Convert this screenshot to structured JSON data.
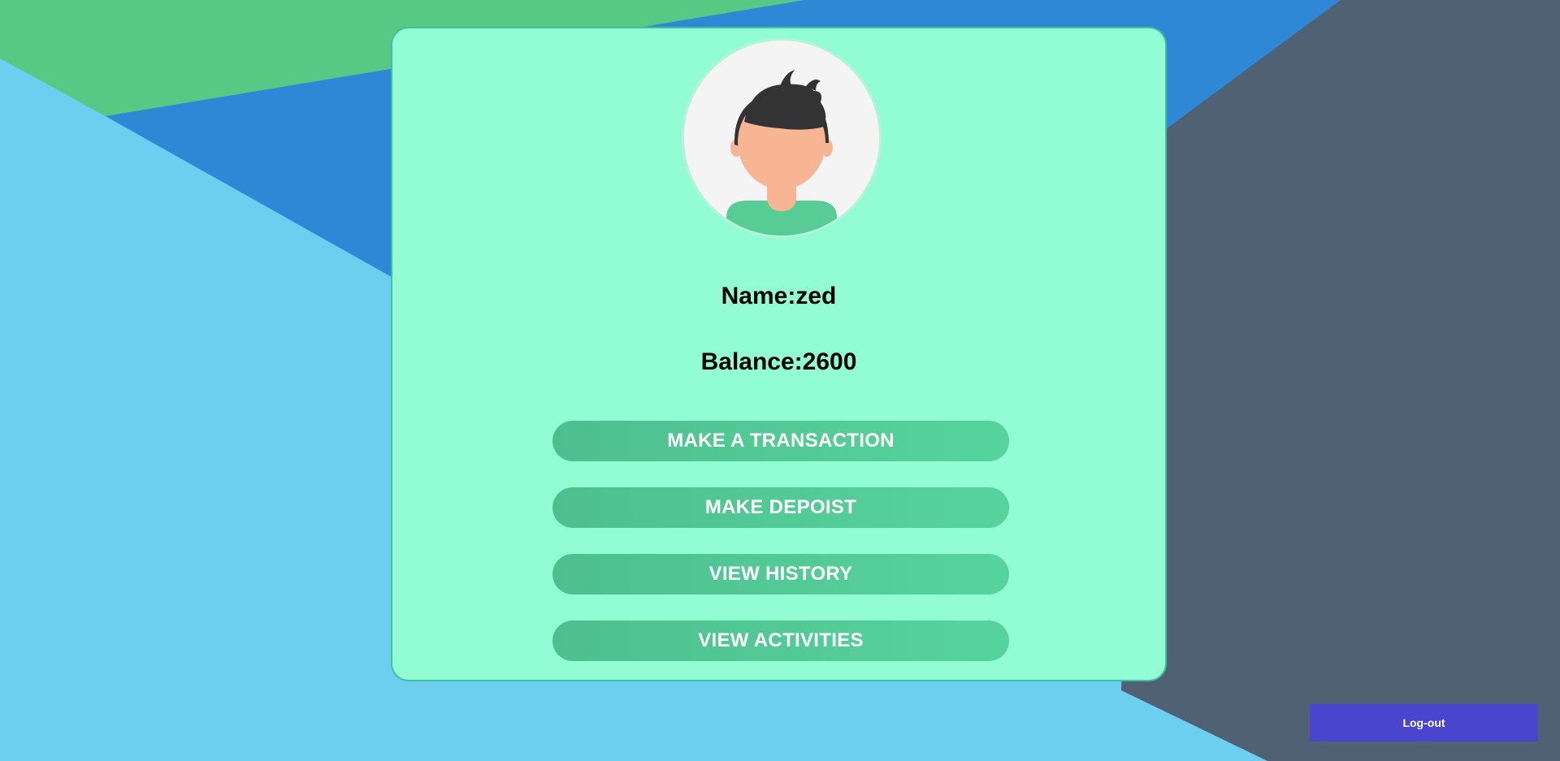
{
  "profile": {
    "name_text": "Name:zed",
    "balance_text": "Balance:2600"
  },
  "actions": {
    "make_transaction": "MAKE A TRANSACTION",
    "make_deposit": "MAKE DEPOIST",
    "view_history": "VIEW HISTORY",
    "view_activities": "VIEW ACTIVITIES"
  },
  "logout": {
    "label": "Log-out"
  },
  "colors": {
    "card_bg": "#92fdd5",
    "button_green": "#53c995",
    "logout_bg": "#4a45cf",
    "bg_light_blue": "#6dcfef",
    "bg_blue": "#2e88d6",
    "bg_green": "#57c985",
    "bg_slate": "#4f6172"
  },
  "icons": {
    "avatar": "user-avatar-illustration"
  }
}
